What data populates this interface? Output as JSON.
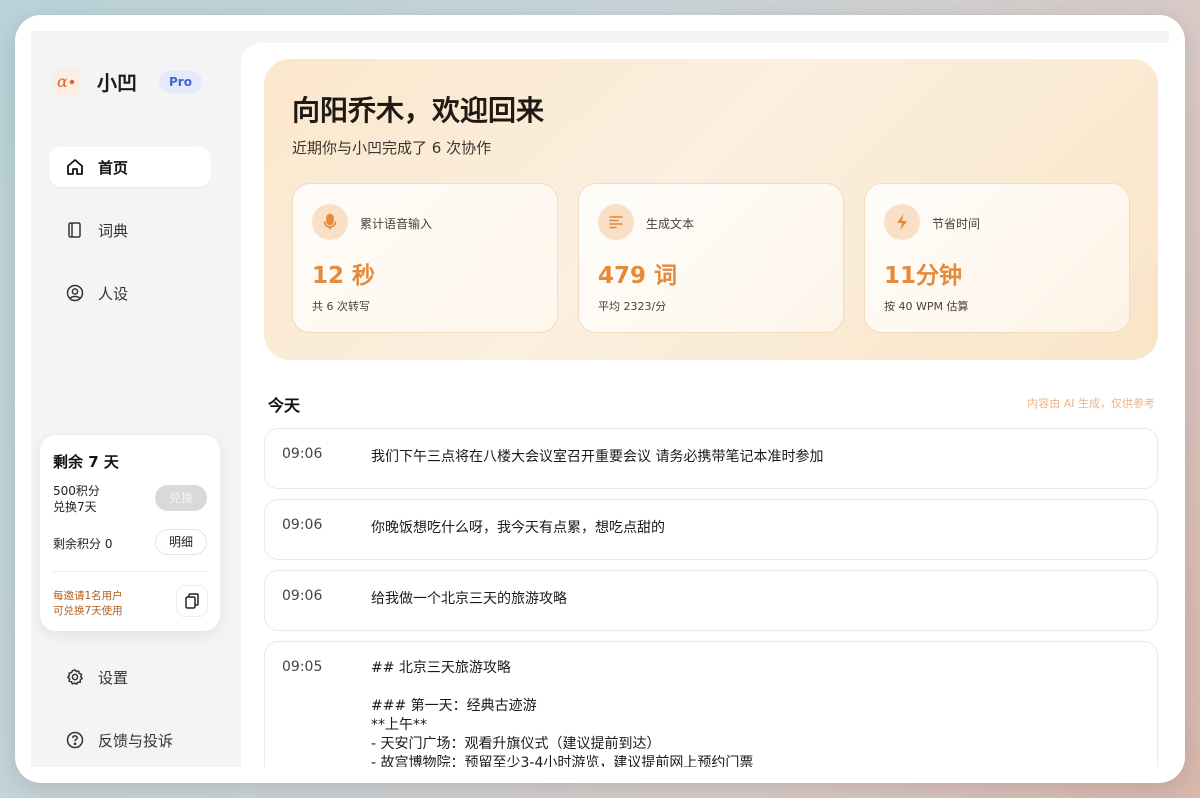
{
  "app": {
    "name": "小凹",
    "badge": "Pro"
  },
  "sidebar": {
    "nav": [
      {
        "label": "首页",
        "icon": "home-icon",
        "active": true
      },
      {
        "label": "词典",
        "icon": "book-icon",
        "active": false
      },
      {
        "label": "人设",
        "icon": "user-circle-icon",
        "active": false
      }
    ],
    "promo": {
      "days_left": "剩余 7 天",
      "points_line1": "500积分",
      "points_line2": "兑换7天",
      "redeem_label": "兑换",
      "remaining_points": "剩余积分 0",
      "detail_label": "明细",
      "invite_line1": "每邀请1名用户",
      "invite_line2": "可兑换7天使用"
    },
    "bottom": [
      {
        "label": "设置",
        "icon": "gear-icon"
      },
      {
        "label": "反馈与投诉",
        "icon": "help-circle-icon"
      }
    ]
  },
  "hero": {
    "title": "向阳乔木，欢迎回来",
    "subtitle": "近期你与小凹完成了 6 次协作",
    "stats": [
      {
        "label": "累计语音输入",
        "value": "12 秒",
        "note": "共 6 次转写",
        "icon": "mic-icon"
      },
      {
        "label": "生成文本",
        "value": "479 词",
        "note": "平均 2323/分",
        "icon": "text-lines-icon"
      },
      {
        "label": "节省时间",
        "value": "11分钟",
        "note": "按 40 WPM 估算",
        "icon": "bolt-icon"
      }
    ]
  },
  "history": {
    "section_title": "今天",
    "ai_note": "内容由 AI 生成，仅供参考",
    "entries": [
      {
        "time": "09:06",
        "text": "我们下午三点将在八楼大会议室召开重要会议 请务必携带笔记本准时参加"
      },
      {
        "time": "09:06",
        "text": "你晚饭想吃什么呀，我今天有点累，想吃点甜的"
      },
      {
        "time": "09:06",
        "text": "给我做一个北京三天的旅游攻略"
      },
      {
        "time": "09:05",
        "lines": [
          "## 北京三天旅游攻略",
          "",
          "### 第一天：经典古迹游",
          "**上午**",
          "- 天安门广场：观看升旗仪式（建议提前到达）",
          "- 故宫博物院：预留至少3-4小时游览，建议提前网上预约门票"
        ]
      }
    ]
  },
  "colors": {
    "accent": "#e38a3d",
    "pro": "#3f64d8",
    "invite": "#b25f1d"
  }
}
